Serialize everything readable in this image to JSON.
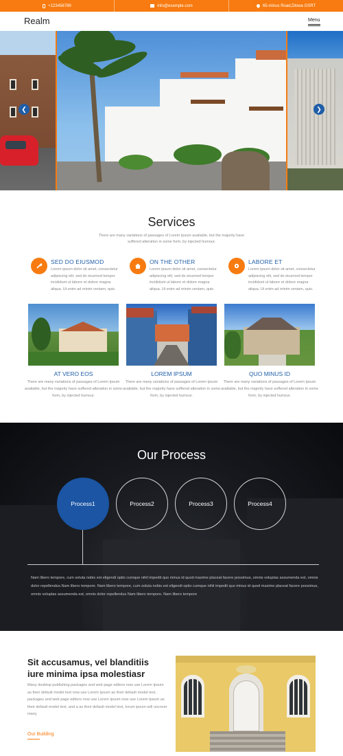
{
  "topbar": {
    "phone": "+123456789",
    "email": "info@example.com",
    "address": "65-minus Road,Dlowa GSRT"
  },
  "nav": {
    "brand": "Realm",
    "menu_label": "Menu"
  },
  "hero": {
    "prev_icon": "chevron-left-icon",
    "next_icon": "chevron-right-icon"
  },
  "services": {
    "title": "Services",
    "subtitle": "There are many variations of passages of Lorem Ipsum available, but the majority have suffered alteration in some form, by injected humour.",
    "features": [
      {
        "title": "SED DO EIUSMOD",
        "icon": "tools-icon",
        "text": "Lorem ipsum dolor sit amet, consectetur adipiscing elit, sed do eiusmod tempor incididunt ut labore et dolore magna aliqua. Ut enim ad minim veniam, quis."
      },
      {
        "title": "ON THE OTHER",
        "icon": "home-icon",
        "text": "Lorem ipsum dolor sit amet, consectetur adipiscing elit, sed do eiusmod tempor incididunt ut labore et dolore magna aliqua. Ut enim ad minim veniam, quis."
      },
      {
        "title": "LABORE ET",
        "icon": "gear-icon",
        "text": "Lorem ipsum dolor sit amet, consectetur adipiscing elit, sed do eiusmod tempor incididunt ut labore et dolore magna aliqua. Ut enim ad minim veniam, quis."
      }
    ],
    "cards": [
      {
        "title": "AT VERO EOS",
        "text": "There are many variations of passages of Lorem Ipsum available, but the majority have suffered alteration in some form, by injected humour."
      },
      {
        "title": "LOREM IPSUM",
        "text": "There are many variations of passages of Lorem Ipsum available, but the majority have suffered alteration in some form, by injected humour."
      },
      {
        "title": "QUO MINUS ID",
        "text": "There are many variations of passages of Lorem Ipsum available, but the majority have suffered alteration in some form, by injected humour."
      }
    ]
  },
  "process": {
    "title": "Our Process",
    "steps": [
      "Process1",
      "Process2",
      "Process3",
      "Process4"
    ],
    "active_step": "Process1",
    "text": "Nam libero tempore, cum soluta nobis est eligendi optio cumque nihil impedit quo minus id quod maxime placeat facere possimus, omnis voluptas assumenda est, omnis dolor repellendus.Nam libero tempore. Nam libero tempore, cum soluta nobis est eligendi optio cumque nihil impedit quo minus id quod maxime placeat facere possimus, omnis voluptas assumenda est, omnis dolor repellendus Nam libero tempore. Nam libero tempore"
  },
  "about": {
    "title": "Sit accusamus, vel blanditiis iure minima ipsa molestiasr",
    "text": "Many desktop publishing packages and web page editors now use Lorem Ipsum as their default model text now use Lorem Ipsum as their default model text, packages and web page editors now use Lorem Ipsum now use Lorem Ipsum as their default model text, and a as their default model text, lorum ipsum will uncover many",
    "link_label": "Our Building"
  },
  "colors": {
    "accent": "#f77b10",
    "primary": "#1f5ea8",
    "dark": "#14161a"
  }
}
